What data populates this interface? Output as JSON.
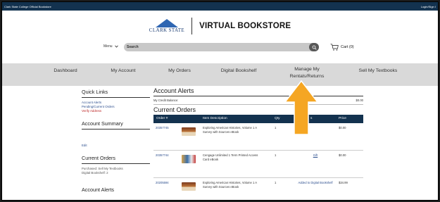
{
  "topbar": {
    "left": "Clark State College Official Bookstore",
    "right": "Login/Sign I"
  },
  "header": {
    "logo_text": "CLARK STATE",
    "title": "VIRTUAL BOOKSTORE"
  },
  "search": {
    "menu_label": "Menu",
    "placeholder": "Search",
    "cart_label": "Cart (0)"
  },
  "nav": [
    "Dashboard",
    "My Account",
    "My Orders",
    "Digital Bookshelf",
    "Manage My Rentals/Returns",
    "Sell My Textbooks"
  ],
  "sidebar": {
    "quick_links": "Quick Links",
    "links": [
      "Account Alerts",
      "Pending/Current Orders"
    ],
    "verify": "Verify Address",
    "summary": "Account Summary",
    "edit": "Edit",
    "current_orders": "Current Orders",
    "purchased": "Purchased: Sell My Textbooks",
    "digital": "Digital Bookshelf: 2",
    "alerts": "Account Alerts"
  },
  "main": {
    "alerts_title": "Account Alerts",
    "credit_label": "My Credit Balance:",
    "credit_value": "$0.00",
    "orders_title": "Current Orders",
    "columns": [
      "Order #",
      "Item Description",
      "Qty",
      "s",
      "Price"
    ],
    "rows": [
      {
        "order": "20357745",
        "desc": "Exploring American Histories, Volume 1 A Survey with Sources eBook",
        "qty": "1",
        "status": "",
        "price": "$0.00"
      },
      {
        "order": "20357744",
        "desc": "Cengage Unlimited 1 Term Printed Access Card eBook",
        "qty": "1",
        "status": "Gift",
        "price": "$0.00"
      },
      {
        "order": "20205594",
        "desc": "Exploring American Histories, Volume 1 A Survey with Sources eBook",
        "qty": "1",
        "status": "Added to Digital Bookshelf",
        "price": "$34.99"
      }
    ]
  },
  "colors": {
    "navy": "#13324f",
    "nav_bg": "#d9d9d9",
    "arrow": "#f5a623"
  }
}
